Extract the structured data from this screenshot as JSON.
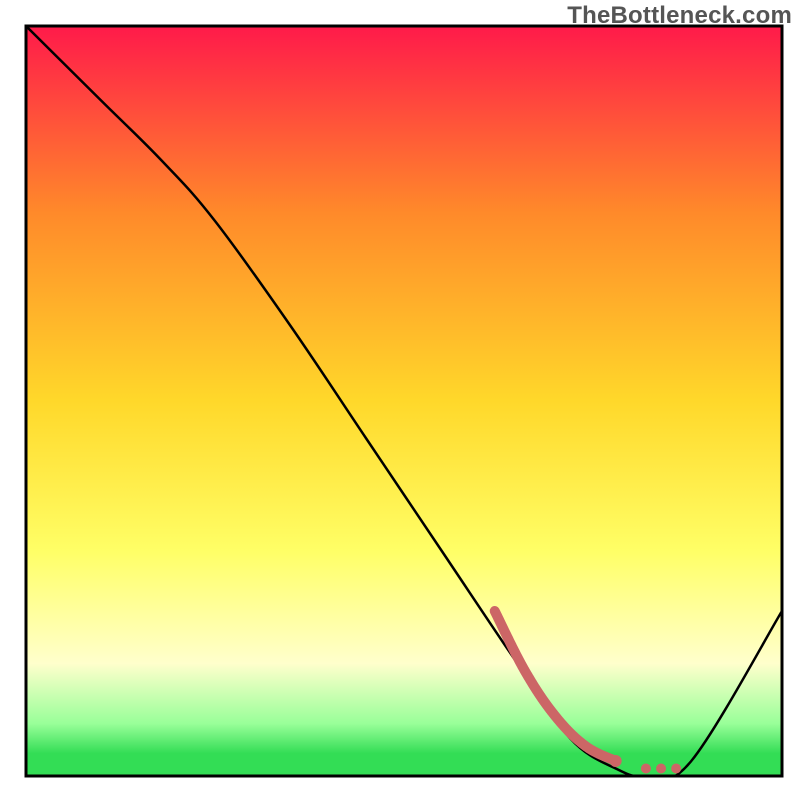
{
  "watermark": "TheBottleneck.com",
  "colors": {
    "gradient_top": "#ff1a4a",
    "gradient_mid_upper": "#ff8a2a",
    "gradient_mid": "#ffd82a",
    "gradient_mid_lower": "#ffff66",
    "gradient_pale": "#ffffcc",
    "gradient_green_light": "#99ff99",
    "gradient_green": "#33dd55",
    "curve_stroke": "#000000",
    "frame_stroke": "#000000",
    "secondary_stroke": "#cc6666",
    "background": "#ffffff"
  },
  "chart_data": {
    "type": "line",
    "title": "",
    "xlabel": "",
    "ylabel": "",
    "xlim": [
      0,
      100
    ],
    "ylim": [
      0,
      100
    ],
    "series": [
      {
        "name": "main-curve",
        "x": [
          0,
          10,
          18,
          25,
          35,
          45,
          55,
          65,
          72,
          78,
          82,
          88,
          100
        ],
        "y": [
          100,
          90,
          82,
          74,
          60,
          45,
          30,
          15,
          5,
          1,
          0,
          2,
          22
        ]
      },
      {
        "name": "secondary-curve",
        "x": [
          62,
          66,
          70,
          74,
          78,
          82,
          84,
          86
        ],
        "y": [
          22,
          14,
          8,
          4,
          2,
          1,
          1,
          1
        ]
      }
    ],
    "annotations": []
  }
}
